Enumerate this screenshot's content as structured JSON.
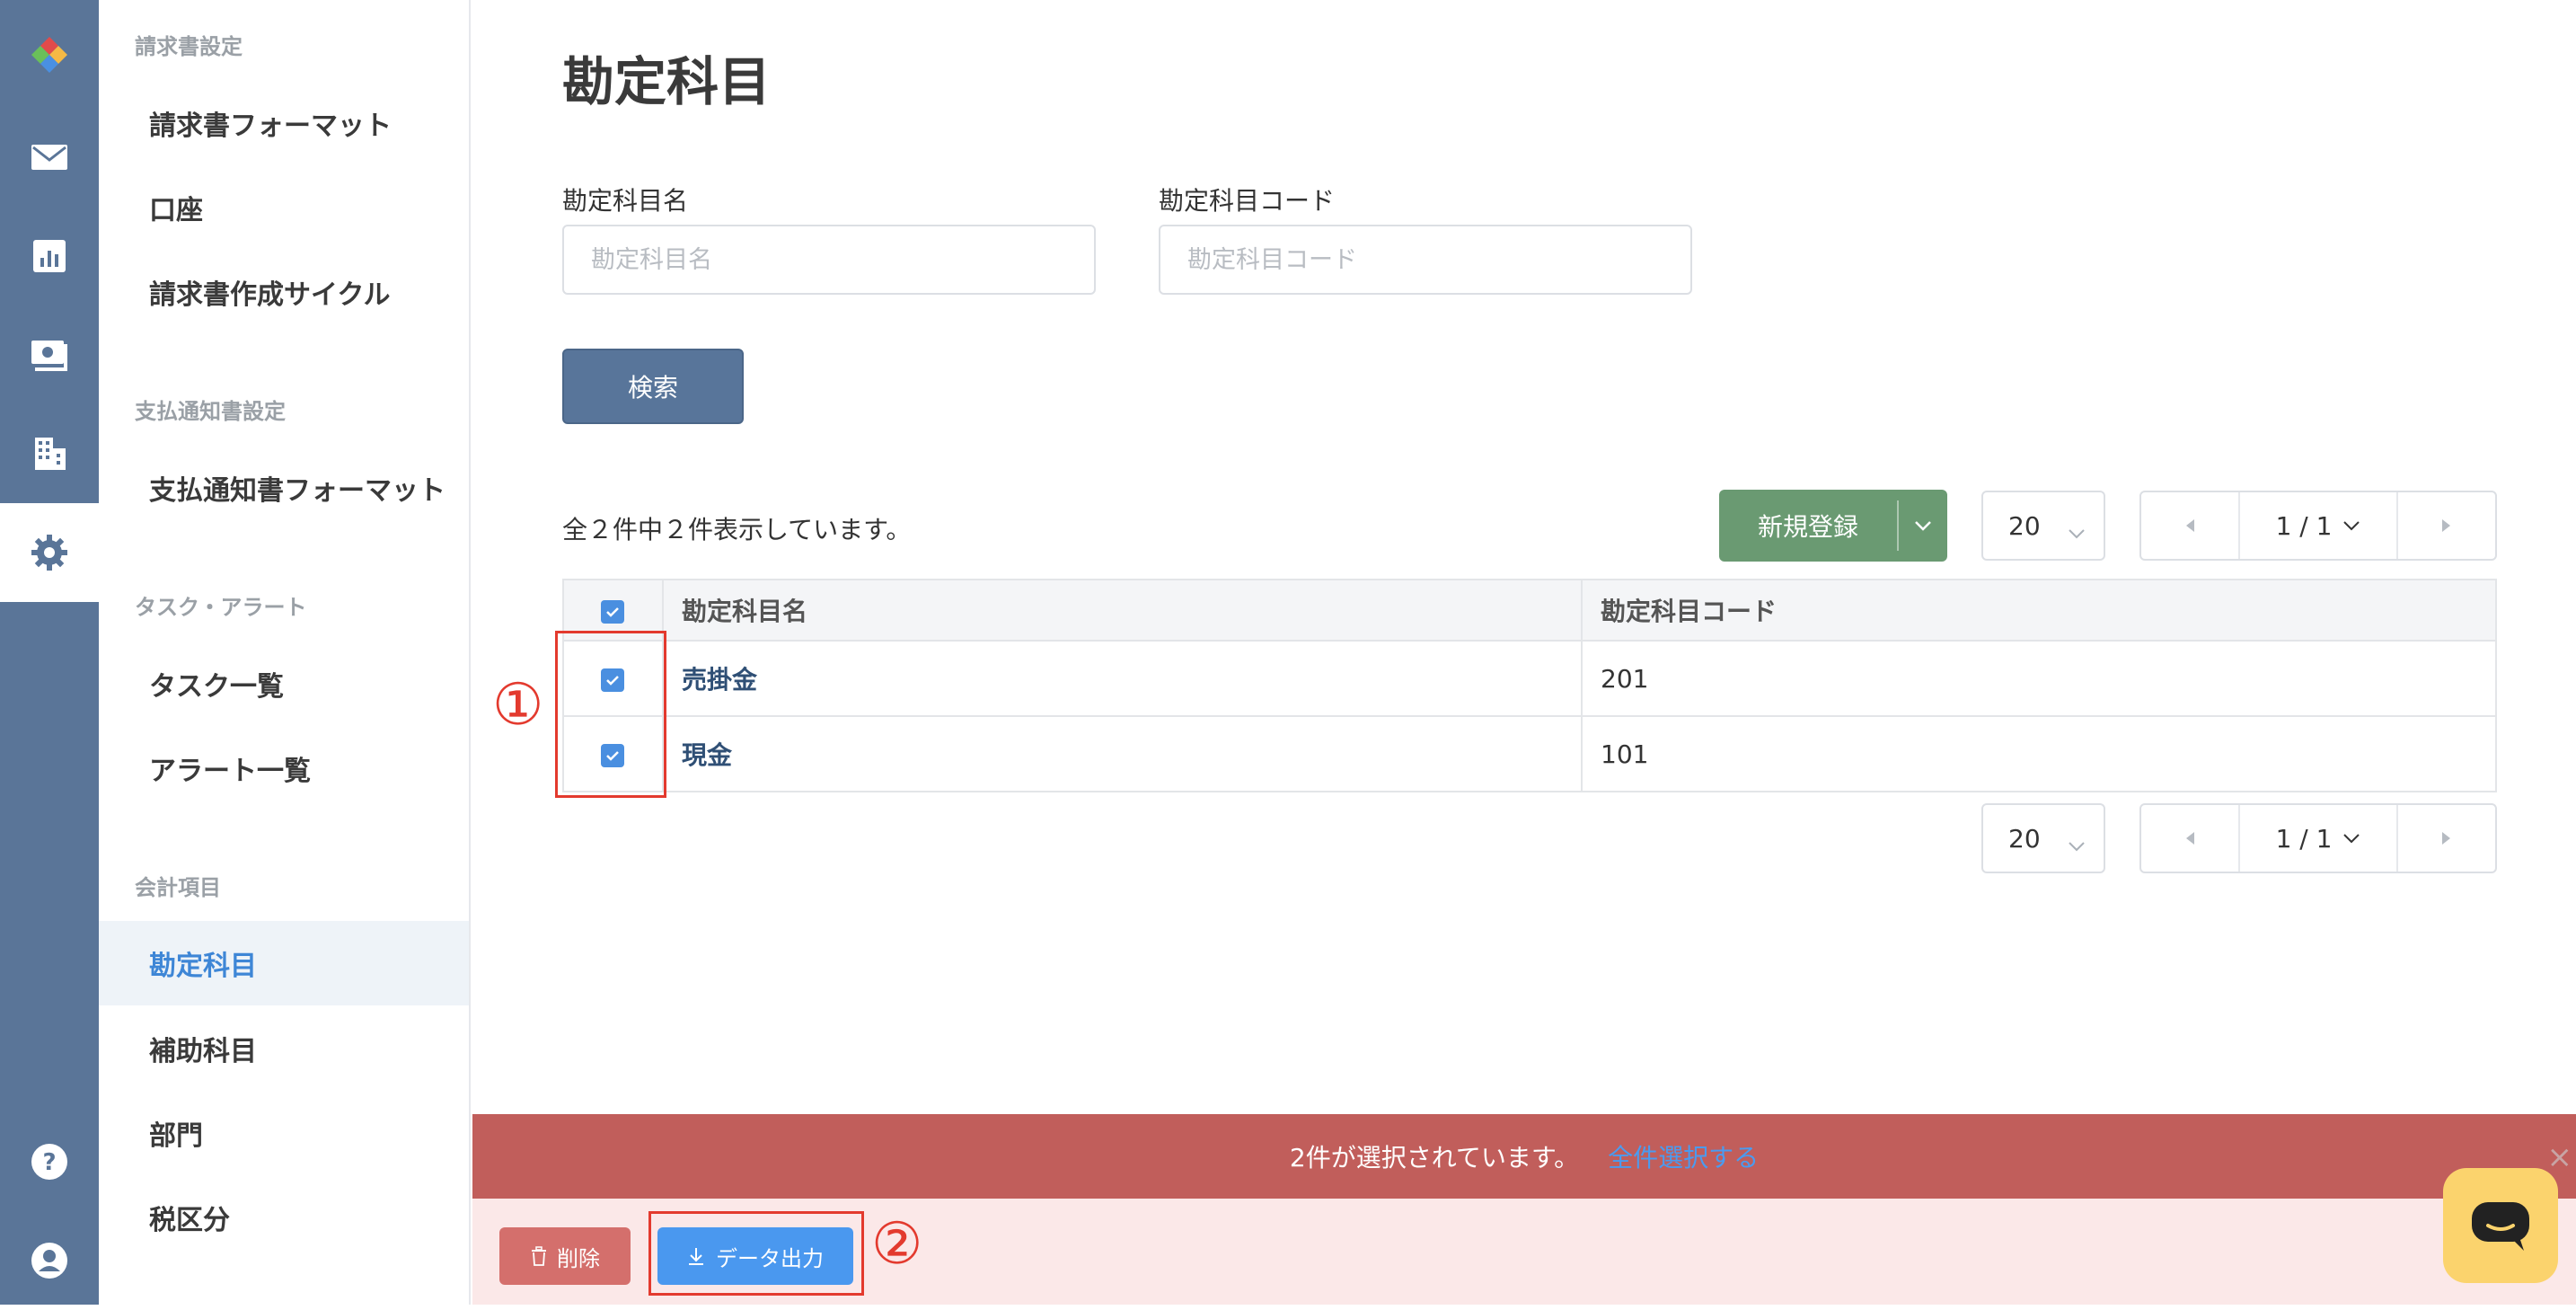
{
  "rail": {
    "icons": [
      "logo-icon",
      "mail-icon",
      "chart-icon",
      "payment-icon",
      "building-icon",
      "gear-icon",
      "help-icon",
      "user-icon"
    ]
  },
  "sidebar": {
    "sections": [
      {
        "title": "請求書設定",
        "items": [
          "請求書フォーマット",
          "口座",
          "請求書作成サイクル"
        ]
      },
      {
        "title": "支払通知書設定",
        "items": [
          "支払通知書フォーマット"
        ]
      },
      {
        "title": "タスク・アラート",
        "items": [
          "タスク一覧",
          "アラート一覧"
        ]
      },
      {
        "title": "会計項目",
        "items": [
          "勘定科目",
          "補助科目",
          "部門",
          "税区分"
        ]
      }
    ],
    "active_item": "勘定科目"
  },
  "main": {
    "title": "勘定科目",
    "filters": {
      "name_label": "勘定科目名",
      "name_placeholder": "勘定科目名",
      "code_label": "勘定科目コード",
      "code_placeholder": "勘定科目コード"
    },
    "search_label": "検索",
    "count_text": "全２件中２件表示しています。",
    "new_button_label": "新規登録",
    "per_page": "20",
    "page_indicator": "1 / 1",
    "table": {
      "columns": [
        "勘定科目名",
        "勘定科目コード"
      ],
      "rows": [
        {
          "name": "売掛金",
          "code": "201",
          "checked": true
        },
        {
          "name": "現金",
          "code": "101",
          "checked": true
        }
      ]
    }
  },
  "annotations": {
    "one": "①",
    "two": "②"
  },
  "selection_bar": {
    "text": "2件が選択されています。",
    "select_all": "全件選択する",
    "close": "×"
  },
  "actions": {
    "delete_label": "削除",
    "export_label": "データ出力"
  },
  "colors": {
    "rail": "#5a7598",
    "accent": "#3e86d6",
    "new_button": "#6a9a72",
    "selection_bar": "#c15e5b",
    "export_button": "#4a98ef"
  }
}
